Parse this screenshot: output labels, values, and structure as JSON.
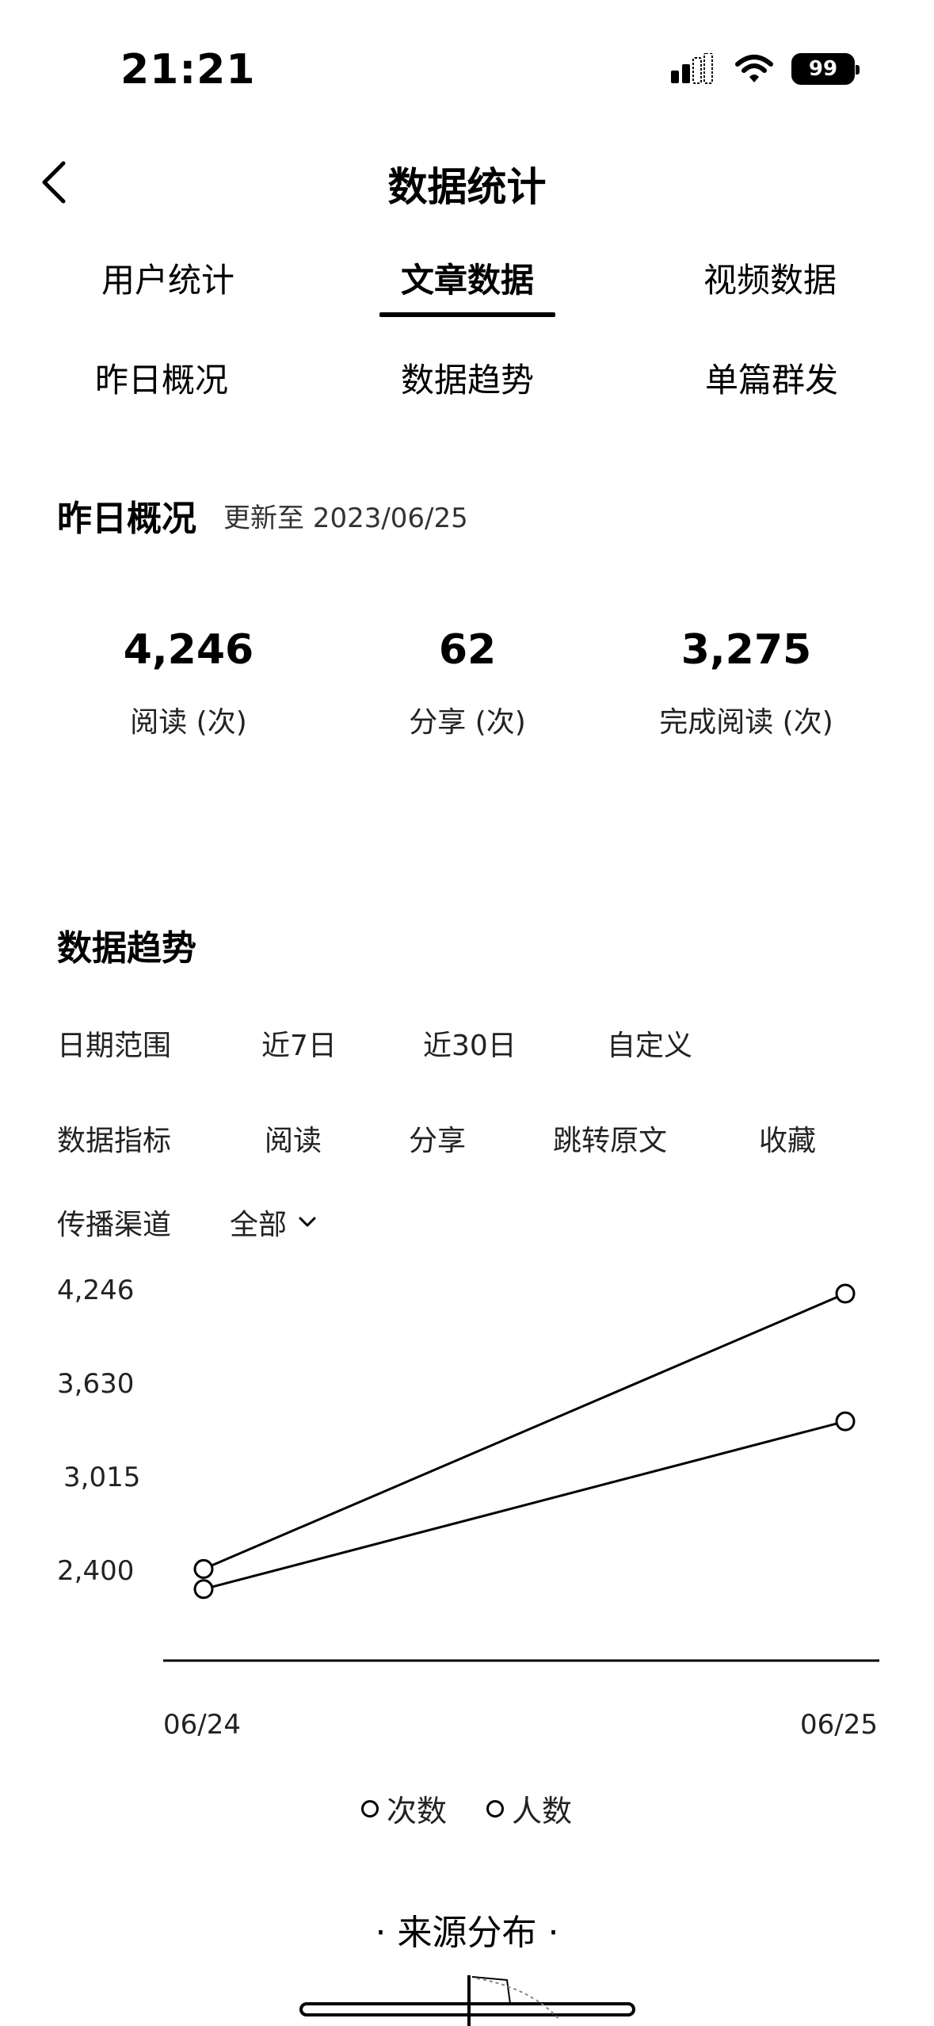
{
  "status_bar": {
    "time": "21:21",
    "battery": "99"
  },
  "header": {
    "title": "数据统计"
  },
  "tabs_row1": [
    "用户统计",
    "文章数据",
    "视频数据"
  ],
  "tabs_row2": [
    "昨日概况",
    "数据趋势",
    "单篇群发"
  ],
  "active_tab": "文章数据",
  "overview": {
    "title": "昨日概况",
    "updated": "更新至 2023/06/25",
    "stats": [
      {
        "value": "4,246",
        "label": "阅读 (次)"
      },
      {
        "value": "62",
        "label": "分享 (次)"
      },
      {
        "value": "3,275",
        "label": "完成阅读 (次)"
      }
    ]
  },
  "trend": {
    "title": "数据趋势",
    "date_range": {
      "label": "日期范围",
      "options": [
        "近7日",
        "近30日",
        "自定义"
      ]
    },
    "metric": {
      "label": "数据指标",
      "options": [
        "阅读",
        "分享",
        "跳转原文",
        "收藏"
      ]
    },
    "channel": {
      "label": "传播渠道",
      "value": "全部"
    }
  },
  "chart_data": {
    "type": "line",
    "x": [
      "06/24",
      "06/25"
    ],
    "y_ticks": [
      "4,246",
      "3,630",
      "3,015",
      "2,400"
    ],
    "ylim": [
      1800,
      4246
    ],
    "series": [
      {
        "name": "次数",
        "values": [
          2153,
          4246
        ]
      },
      {
        "name": "人数",
        "values": [
          2000,
          3275
        ]
      }
    ],
    "grid": false,
    "legend_position": "bottom"
  },
  "source": {
    "title": "· 来源分布 ·"
  }
}
